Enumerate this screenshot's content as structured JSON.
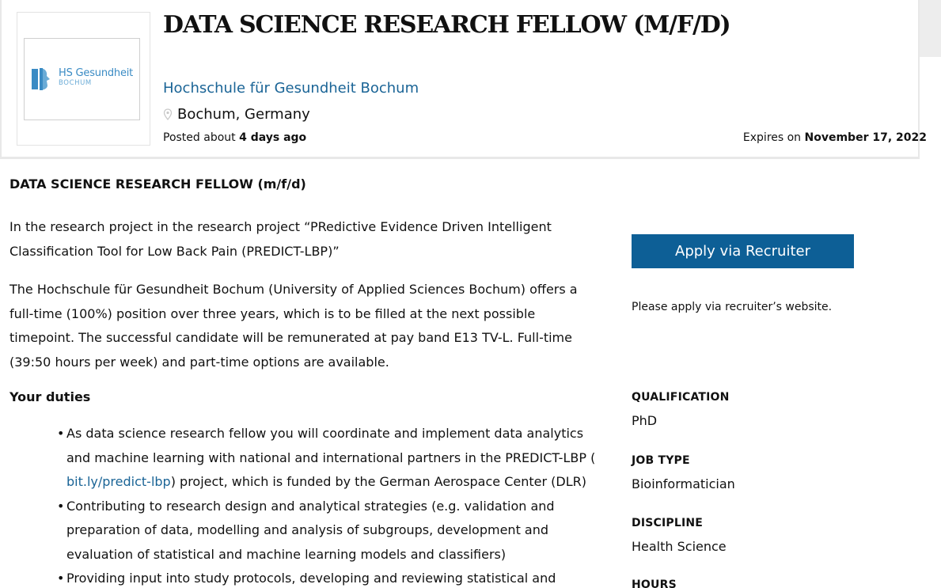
{
  "header": {
    "title": "DATA SCIENCE RESEARCH FELLOW (M/F/D)",
    "logo_line1": "HS Gesundheit",
    "logo_line2": "BOCHUM",
    "employer": "Hochschule für Gesundheit Bochum",
    "location": "Bochum, Germany",
    "posted_prefix": "Posted about",
    "posted_value": "4 days ago",
    "expires_prefix": "Expires on",
    "expires_value": "November 17, 2022",
    "icons": {
      "location": "map-pin-icon"
    }
  },
  "body": {
    "ad_title": "DATA SCIENCE RESEARCH FELLOW (m/f/d)",
    "para1": "In the research project in the research project “PRedictive Evidence Driven Intelligent Classification Tool for Low Back Pain (PREDICT-LBP)”",
    "para2": "The Hochschule für Gesundheit Bochum (University of Applied Sciences Bochum) offers a full-time (100%) position over three years, which is to be filled at the next possible timepoint. The successful candidate will be remunerated at pay band E13 TV-L. Full-time (39:50 hours per week) and part-time options are available.",
    "duties_heading": "Your duties",
    "duty1_before": "As data science research fellow you will coordinate and implement data analytics and machine learning with national and international partners in the PREDICT-LBP ( ",
    "duty1_link": "bit.ly/predict-lbp",
    "duty1_after": ") project, which is funded by the German Aerospace Center (DLR)",
    "duty2": "Contributing to research design and analytical strategies (e.g. validation and preparation of data, modelling and analysis of subgroups, development and evaluation of statistical and machine learning models and classifiers)",
    "duty3": "Providing input into study protocols, developing and reviewing statistical and"
  },
  "sidebar": {
    "apply_label": "Apply via Recruiter",
    "apply_note": "Please apply via recruiter’s website.",
    "qualification_label": "QUALIFICATION",
    "qualification_value": "PhD",
    "job_type_label": "JOB TYPE",
    "job_type_value": "Bioinformatician",
    "discipline_label": "DISCIPLINE",
    "discipline_value": "Health Science",
    "hours_label": "HOURS"
  },
  "colors": {
    "accent": "#0d5f96",
    "link": "#1a6496",
    "logo": "#3a8bc4"
  }
}
